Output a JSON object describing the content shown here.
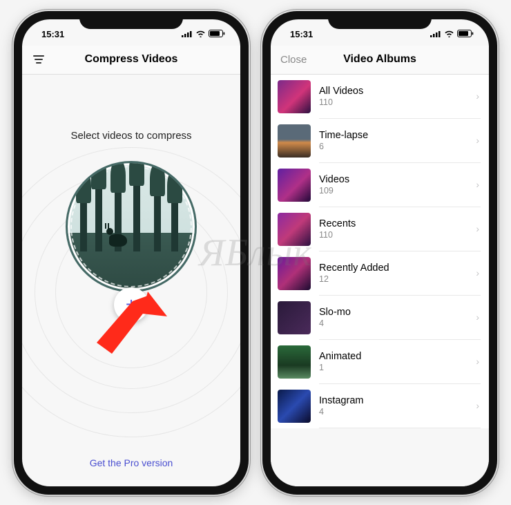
{
  "status": {
    "time": "15:31"
  },
  "left_screen": {
    "title": "Compress Videos",
    "select_label": "Select videos to compress",
    "add_glyph": "+",
    "pro_link": "Get the Pro version"
  },
  "right_screen": {
    "close_label": "Close",
    "title": "Video Albums",
    "albums": [
      {
        "name": "All Videos",
        "count": "110",
        "thumb_class": "purple1"
      },
      {
        "name": "Time-lapse",
        "count": "6",
        "thumb_class": "sunset"
      },
      {
        "name": "Videos",
        "count": "109",
        "thumb_class": "purple2"
      },
      {
        "name": "Recents",
        "count": "110",
        "thumb_class": "purple3"
      },
      {
        "name": "Recently Added",
        "count": "12",
        "thumb_class": "purple4"
      },
      {
        "name": "Slo-mo",
        "count": "4",
        "thumb_class": "dark"
      },
      {
        "name": "Animated",
        "count": "1",
        "thumb_class": "green"
      },
      {
        "name": "Instagram",
        "count": "4",
        "thumb_class": "blue"
      }
    ]
  },
  "watermark_text": "ЯБлык"
}
